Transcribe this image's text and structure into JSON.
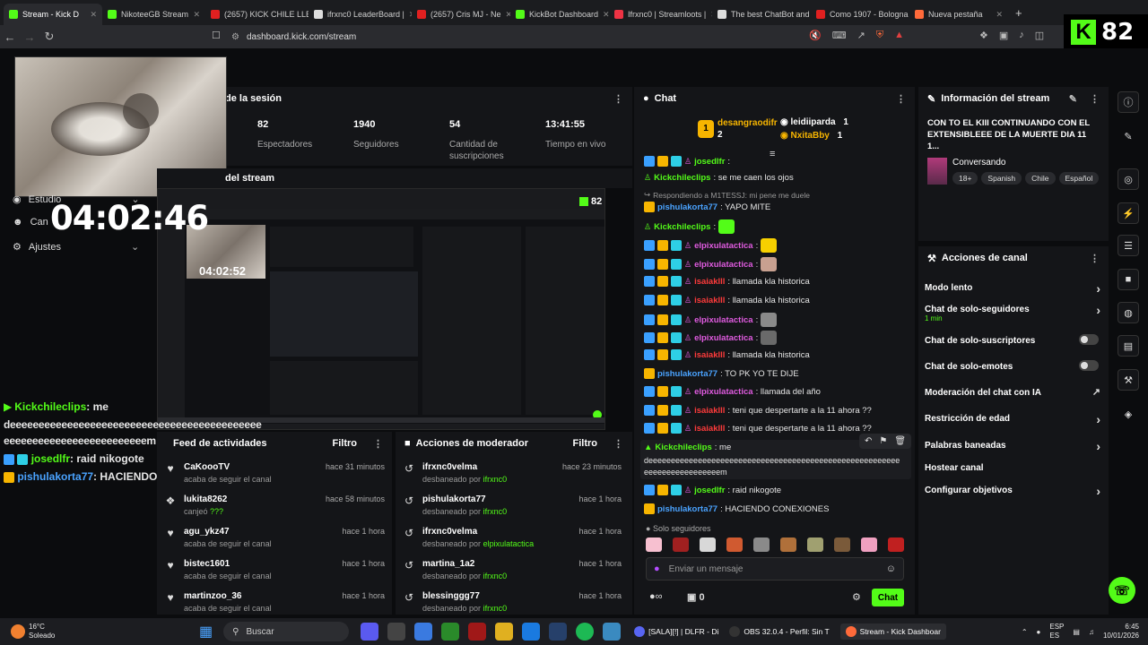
{
  "browser": {
    "tabs": [
      {
        "label": "Stream - Kick D",
        "color": "#53fc18",
        "active": true
      },
      {
        "label": "NikoteeGB Stream",
        "color": "#53fc18"
      },
      {
        "label": "(2657) KICK CHILE LLEG",
        "color": "#e02020"
      },
      {
        "label": "ifrxnc0 LeaderBoard |",
        "color": "#dddddd"
      },
      {
        "label": "(2657) Cris MJ - Ne",
        "color": "#e02020"
      },
      {
        "label": "KickBot Dashboard",
        "color": "#53fc18"
      },
      {
        "label": "Ifrxnc0 | Streamloots |",
        "color": "#ee3344"
      },
      {
        "label": "The best ChatBot and",
        "color": "#dddddd"
      },
      {
        "label": "Como 1907 - Bologna",
        "color": "#e02020"
      },
      {
        "label": "Nueva pestaña",
        "color": "#ff6a3a"
      }
    ],
    "url": "dashboard.kick.com/stream",
    "new_tab": "+"
  },
  "kick_badge": {
    "letter": "K",
    "count": "82"
  },
  "overlay": {
    "clock": "04:02:46",
    "menu": [
      {
        "label": "Estudio",
        "icon": "studio-icon"
      },
      {
        "label": "Can",
        "icon": "channel-icon"
      },
      {
        "label": "Ajustes",
        "icon": "gear-icon"
      }
    ],
    "chat_overlay": {
      "line1_user": "Kickchileclips",
      "line1_text": ": me",
      "line2": "deeeeeeeeeeeeeeeeeeeeeeeeeeeeeeeeeeeeeeeeeeee",
      "line3": "eeeeeeeeeeeeeeeeeeeeeeeeem",
      "line4_user": "josedlfr",
      "line4_text": ": raid nikogote",
      "line5_user": "pishulakorta77",
      "line5_text": ": HACIENDO CONEXIONES"
    }
  },
  "session": {
    "title": "de la sesión",
    "stats": [
      {
        "value": "82",
        "label": "Espectadores"
      },
      {
        "value": "1940",
        "label": "Seguidores"
      },
      {
        "value": "54",
        "label": "Cantidad de suscripciones"
      },
      {
        "value": "13:41:55",
        "label": "Tiempo en vivo"
      }
    ]
  },
  "preview": {
    "title": "del stream",
    "clock": "04:02:52",
    "count": "82"
  },
  "feed": {
    "title": "Feed de actividades",
    "filter": "Filtro",
    "items": [
      {
        "name": "CaKoooTV",
        "sub": "acaba de seguir el canal",
        "time": "hace 31 minutos",
        "icon": "heart-icon"
      },
      {
        "name": "lukita8262",
        "sub": "canjeó",
        "extra": "???",
        "time": "hace 58 minutos",
        "icon": "redeem-icon"
      },
      {
        "name": "agu_ykz47",
        "sub": "acaba de seguir el canal",
        "time": "hace 1 hora",
        "icon": "heart-icon"
      },
      {
        "name": "bistec1601",
        "sub": "acaba de seguir el canal",
        "time": "hace 1 hora",
        "icon": "heart-icon"
      },
      {
        "name": "martinzoo_36",
        "sub": "acaba de seguir el canal",
        "time": "hace 1 hora",
        "icon": "heart-icon"
      }
    ]
  },
  "mod": {
    "title": "Acciones de moderador",
    "filter": "Filtro",
    "items": [
      {
        "name": "ifrxnc0velma",
        "sub": "desbaneado por",
        "by": "ifrxnc0",
        "time": "hace 23 minutos"
      },
      {
        "name": "pishulakorta77",
        "sub": "desbaneado por",
        "by": "ifrxnc0",
        "time": "hace 1 hora"
      },
      {
        "name": "ifrxnc0velma",
        "sub": "desbaneado por",
        "by": "elpixulatactica",
        "time": "hace 1 hora"
      },
      {
        "name": "martina_1a2",
        "sub": "desbaneado por",
        "by": "ifrxnc0",
        "time": "hace 1 hora"
      },
      {
        "name": "blessinggg77",
        "sub": "desbaneado por",
        "by": "ifrxnc0",
        "time": "hace 1 hora"
      }
    ]
  },
  "chat": {
    "title": "Chat",
    "top": [
      {
        "rank": "1",
        "name": "desangraodifr",
        "count": "2"
      },
      {
        "name": "leidiiparda",
        "count": "1"
      },
      {
        "name": "NxitaBby",
        "count": "1"
      }
    ],
    "lines": [
      {
        "badges": 3,
        "user": "josedlfr",
        "color": "#53fc18",
        "text": ":"
      },
      {
        "badges": 0,
        "user": "Kickchileclips",
        "color": "#53fc18",
        "text": ": se me caen los ojos"
      },
      {
        "badges": 0,
        "reply": true,
        "text": "Respondiendo a M1TESSJ: mi pene me duele"
      },
      {
        "badges": 1,
        "user": "pishulakorta77",
        "color": "#4aa3ff",
        "text": ": YAPO MITE"
      },
      {
        "badges": 0,
        "user": "Kickchileclips",
        "color": "#53fc18",
        "text": ":"
      },
      {
        "badges": 3,
        "user": "elpixulatactica",
        "color": "#e05be0",
        "text": ":"
      },
      {
        "badges": 3,
        "user": "elpixulatactica",
        "color": "#e05be0",
        "text": ":"
      },
      {
        "badges": 3,
        "user": "isaiaklll",
        "color": "#ff3b3b",
        "text": ": llamada kla historica"
      },
      {
        "badges": 3,
        "user": "isaiaklll",
        "color": "#ff3b3b",
        "text": ": llamada kla historica"
      },
      {
        "badges": 3,
        "user": "elpixulatactica",
        "color": "#e05be0",
        "text": ":"
      },
      {
        "badges": 3,
        "user": "elpixulatactica",
        "color": "#e05be0",
        "text": ":"
      },
      {
        "badges": 3,
        "user": "isaiaklll",
        "color": "#ff3b3b",
        "text": ": llamada kla historica"
      },
      {
        "badges": 1,
        "user": "pishulakorta77",
        "color": "#4aa3ff",
        "text": ": TO PK YO TE DIJE"
      },
      {
        "badges": 3,
        "user": "elpixulatactica",
        "color": "#e05be0",
        "text": ": llamada del año"
      },
      {
        "badges": 3,
        "user": "isaiaklll",
        "color": "#ff3b3b",
        "text": ": teni que despertarte a la 11 ahora ??"
      },
      {
        "badges": 3,
        "user": "isaiaklll",
        "color": "#ff3b3b",
        "text": ": teni que despertarte a la 11 ahora ??"
      }
    ],
    "highlight": {
      "user": "Kickchileclips",
      "text": ": me",
      "cont": "deeeeeeeeeeeeeeeeeeeeeeeeeeeeeeeeeeeeeeeeeeeeeeeeeeeeeeee",
      "cont2": "eeeeeeeeeeeeeeeeem"
    },
    "after": [
      {
        "badges": 3,
        "user": "josedlfr",
        "color": "#53fc18",
        "text": ": raid nikogote"
      },
      {
        "badges": 1,
        "user": "pishulakorta77",
        "color": "#4aa3ff",
        "text": ": HACIENDO CONEXIONES"
      }
    ],
    "mode": "Solo seguidores",
    "placeholder": "Enviar un mensaje",
    "points": "0",
    "send": "Chat"
  },
  "info": {
    "title": "Información del stream",
    "stream_title": "CON TO EL KIII CONTINUANDO CON EL EXTENSIBLEEE DE LA MUERTE DIA 11 1...",
    "category": "Conversando",
    "tags": [
      "18+",
      "Spanish",
      "Chile",
      "Español"
    ]
  },
  "actions": {
    "title": "Acciones de canal",
    "items": [
      {
        "label": "Modo lento",
        "type": "arrow"
      },
      {
        "label": "Chat de solo-seguidores",
        "sub": "1 min",
        "type": "arrow"
      },
      {
        "label": "Chat de solo-suscriptores",
        "type": "toggle"
      },
      {
        "label": "Chat de solo-emotes",
        "type": "toggle"
      },
      {
        "label": "Moderación del chat con IA",
        "type": "ext"
      },
      {
        "label": "Restricción de edad",
        "type": "arrow"
      },
      {
        "label": "Palabras baneadas",
        "type": "arrow"
      },
      {
        "label": "Hostear canal",
        "type": "none"
      },
      {
        "label": "Configurar objetivos",
        "type": "arrow"
      }
    ]
  },
  "taskbar": {
    "weather_temp": "16°C",
    "weather_desc": "Soleado",
    "search": "Buscar",
    "apps": [
      {
        "label": "[SALA][!] | DLFR - Di"
      },
      {
        "label": "OBS 32.0.4 - Perfil: Sin T"
      },
      {
        "label": "Stream - Kick Dashboar"
      }
    ],
    "lang1": "ESP",
    "lang2": "ES",
    "time": "6:45",
    "date": "10/01/2026"
  }
}
